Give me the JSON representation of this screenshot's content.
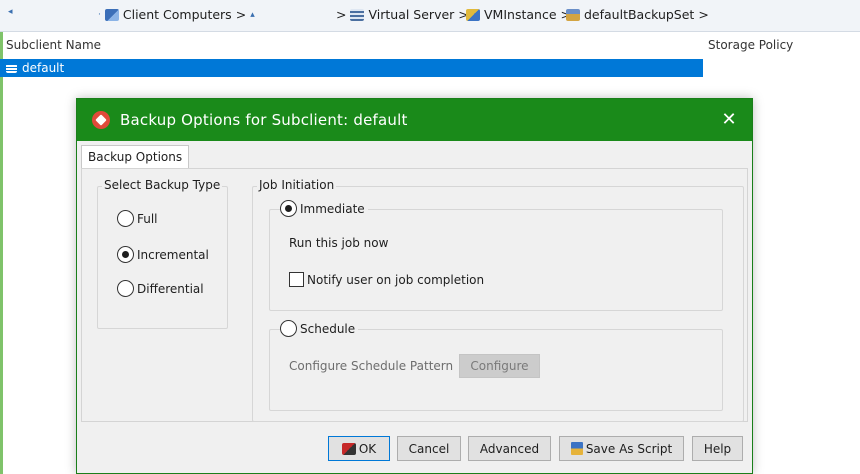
{
  "breadcrumb": {
    "items": [
      {
        "icon": "computers-icon",
        "label": "Client Computers",
        "sep": ">"
      },
      {
        "icon": "virtual-server-icon",
        "label": "Virtual Server",
        "sep": ">"
      },
      {
        "icon": "vminstance-icon",
        "label": "VMInstance",
        "sep": ">"
      },
      {
        "icon": "backupset-icon",
        "label": "defaultBackupSet",
        "sep": ">"
      }
    ],
    "lead_sep": ">"
  },
  "table": {
    "columns": [
      "Subclient Name",
      "Storage Policy"
    ],
    "rows": [
      {
        "name": "default",
        "icon": "subclient-icon"
      }
    ]
  },
  "dialog": {
    "title": "Backup Options for Subclient: default",
    "close_label": "✕",
    "tab_label": "Backup Options",
    "backup_type": {
      "label": "Select Backup Type",
      "options": [
        "Full",
        "Incremental",
        "Differential"
      ],
      "selected": "Incremental"
    },
    "job_initiation": {
      "label": "Job Initiation",
      "immediate_label": "Immediate",
      "immediate_desc": "Run this job now",
      "notify_label": "Notify user on job completion",
      "notify_checked": false,
      "schedule_label": "Schedule",
      "schedule_pattern_label": "Configure Schedule Pattern",
      "configure_button": "Configure",
      "selected": "Immediate"
    },
    "buttons": {
      "ok": "OK",
      "cancel": "Cancel",
      "advanced": "Advanced",
      "save_script": "Save As Script",
      "help": "Help"
    }
  },
  "colors": {
    "titlebar": "#1a8a1a",
    "selection": "#0078d7"
  }
}
